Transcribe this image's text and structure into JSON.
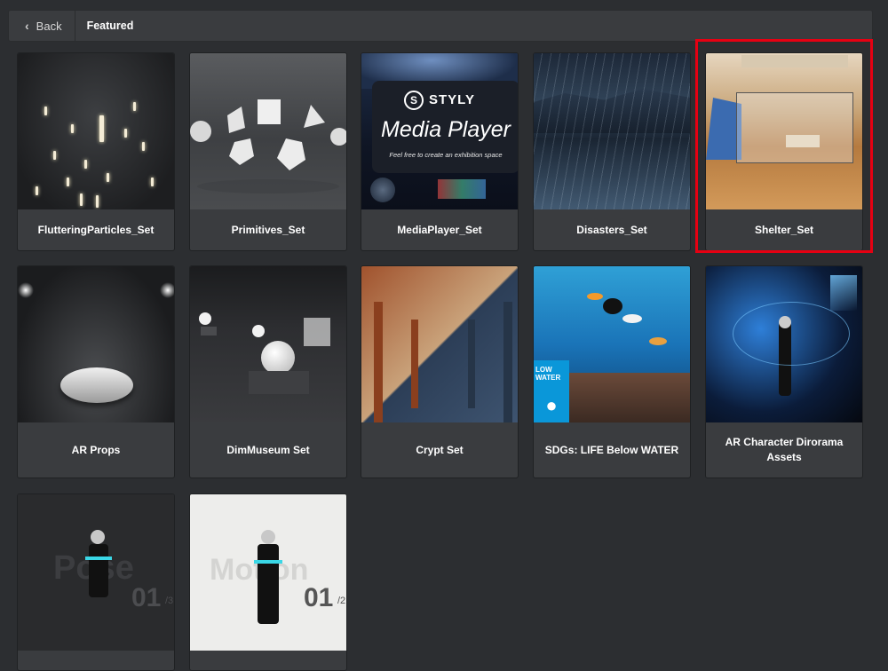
{
  "header": {
    "back_label": "Back",
    "breadcrumb": "Featured"
  },
  "cards": [
    {
      "title": "FlutteringParticles_Set"
    },
    {
      "title": "Primitives_Set"
    },
    {
      "title": "MediaPlayer_Set"
    },
    {
      "title": "Disasters_Set"
    },
    {
      "title": "Shelter_Set"
    },
    {
      "title": "AR Props"
    },
    {
      "title": "DimMuseum Set"
    },
    {
      "title": "Crypt Set"
    },
    {
      "title": "SDGs: LIFE Below WATER"
    },
    {
      "title": "AR Character Dirorama Assets"
    },
    {
      "title": ""
    },
    {
      "title": ""
    }
  ],
  "media_thumb": {
    "brand": "STYLY",
    "heading": "Media Player",
    "tagline": "Feel free to create an exhibition space"
  },
  "sdg_thumb": {
    "badge_text": "LOW WATER"
  },
  "pose_thumb": {
    "word": "Pose",
    "number": "01",
    "suffix": "/3"
  },
  "motion_thumb": {
    "word": "Motion",
    "number": "01",
    "suffix": "/2"
  },
  "colors": {
    "background": "#2c2e31",
    "card": "#3a3c3f",
    "selection": "#e60012"
  }
}
